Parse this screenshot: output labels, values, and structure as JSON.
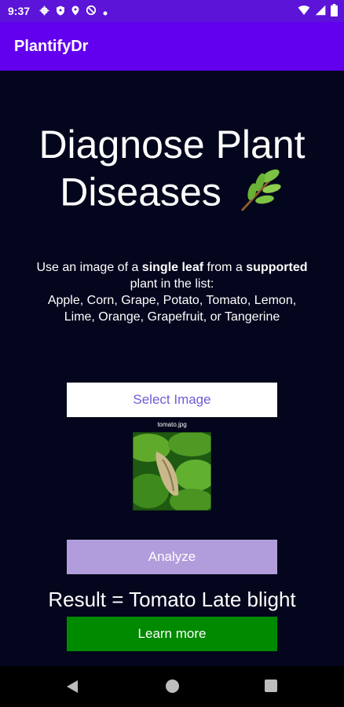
{
  "status": {
    "time": "9:37",
    "icons_left": [
      "settings-icon",
      "shield-icon",
      "location-icon",
      "data-saver-icon",
      "dot-icon"
    ],
    "icons_right": [
      "wifi-icon",
      "signal-icon",
      "battery-icon"
    ]
  },
  "app": {
    "title": "PlantifyDr"
  },
  "main": {
    "heading_line1": "Diagnose Plant",
    "heading_line2": "Diseases",
    "heading_emoji_icon": "herb-leaf-icon",
    "desc_prefix": "Use an image of a ",
    "desc_bold1": "single leaf",
    "desc_mid": " from a ",
    "desc_bold2": "supported",
    "desc_line2": "plant in the list:",
    "desc_line3": "Apple, Corn, Grape, Potato, Tomato, Lemon,",
    "desc_line4": "Lime, Orange, Grapefruit, or Tangerine",
    "select_label": "Select Image",
    "file_name": "tomato.jpg",
    "analyze_label": "Analyze",
    "result_text": "Result = Tomato Late blight",
    "learn_label": "Learn more"
  },
  "colors": {
    "status_bar": "#5b14d8",
    "app_bar": "#6200ee",
    "background": "#03061c",
    "select_text": "#6f5cd6",
    "analyze_bg": "#b19ddb",
    "learn_bg": "#008a00"
  }
}
